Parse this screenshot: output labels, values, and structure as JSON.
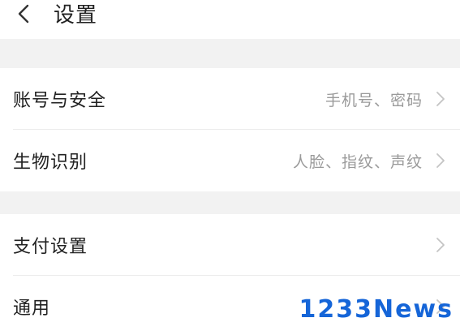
{
  "header": {
    "title": "设置",
    "back_icon": "chevron-left-icon"
  },
  "groups": [
    {
      "items": [
        {
          "label": "账号与安全",
          "value": "手机号、密码",
          "icon": "chevron-right-icon"
        },
        {
          "label": "生物识别",
          "value": "人脸、指纹、声纹",
          "icon": "chevron-right-icon"
        }
      ]
    },
    {
      "items": [
        {
          "label": "支付设置",
          "value": "",
          "icon": "chevron-right-icon"
        },
        {
          "label": "通用",
          "value": "",
          "icon": "chevron-right-icon"
        }
      ]
    }
  ],
  "watermark": {
    "text": "1233News"
  },
  "colors": {
    "background": "#f2f2f2",
    "card": "#ffffff",
    "primary_text": "#222222",
    "secondary_text": "#9a9a9a",
    "accent": "#1565d8"
  }
}
